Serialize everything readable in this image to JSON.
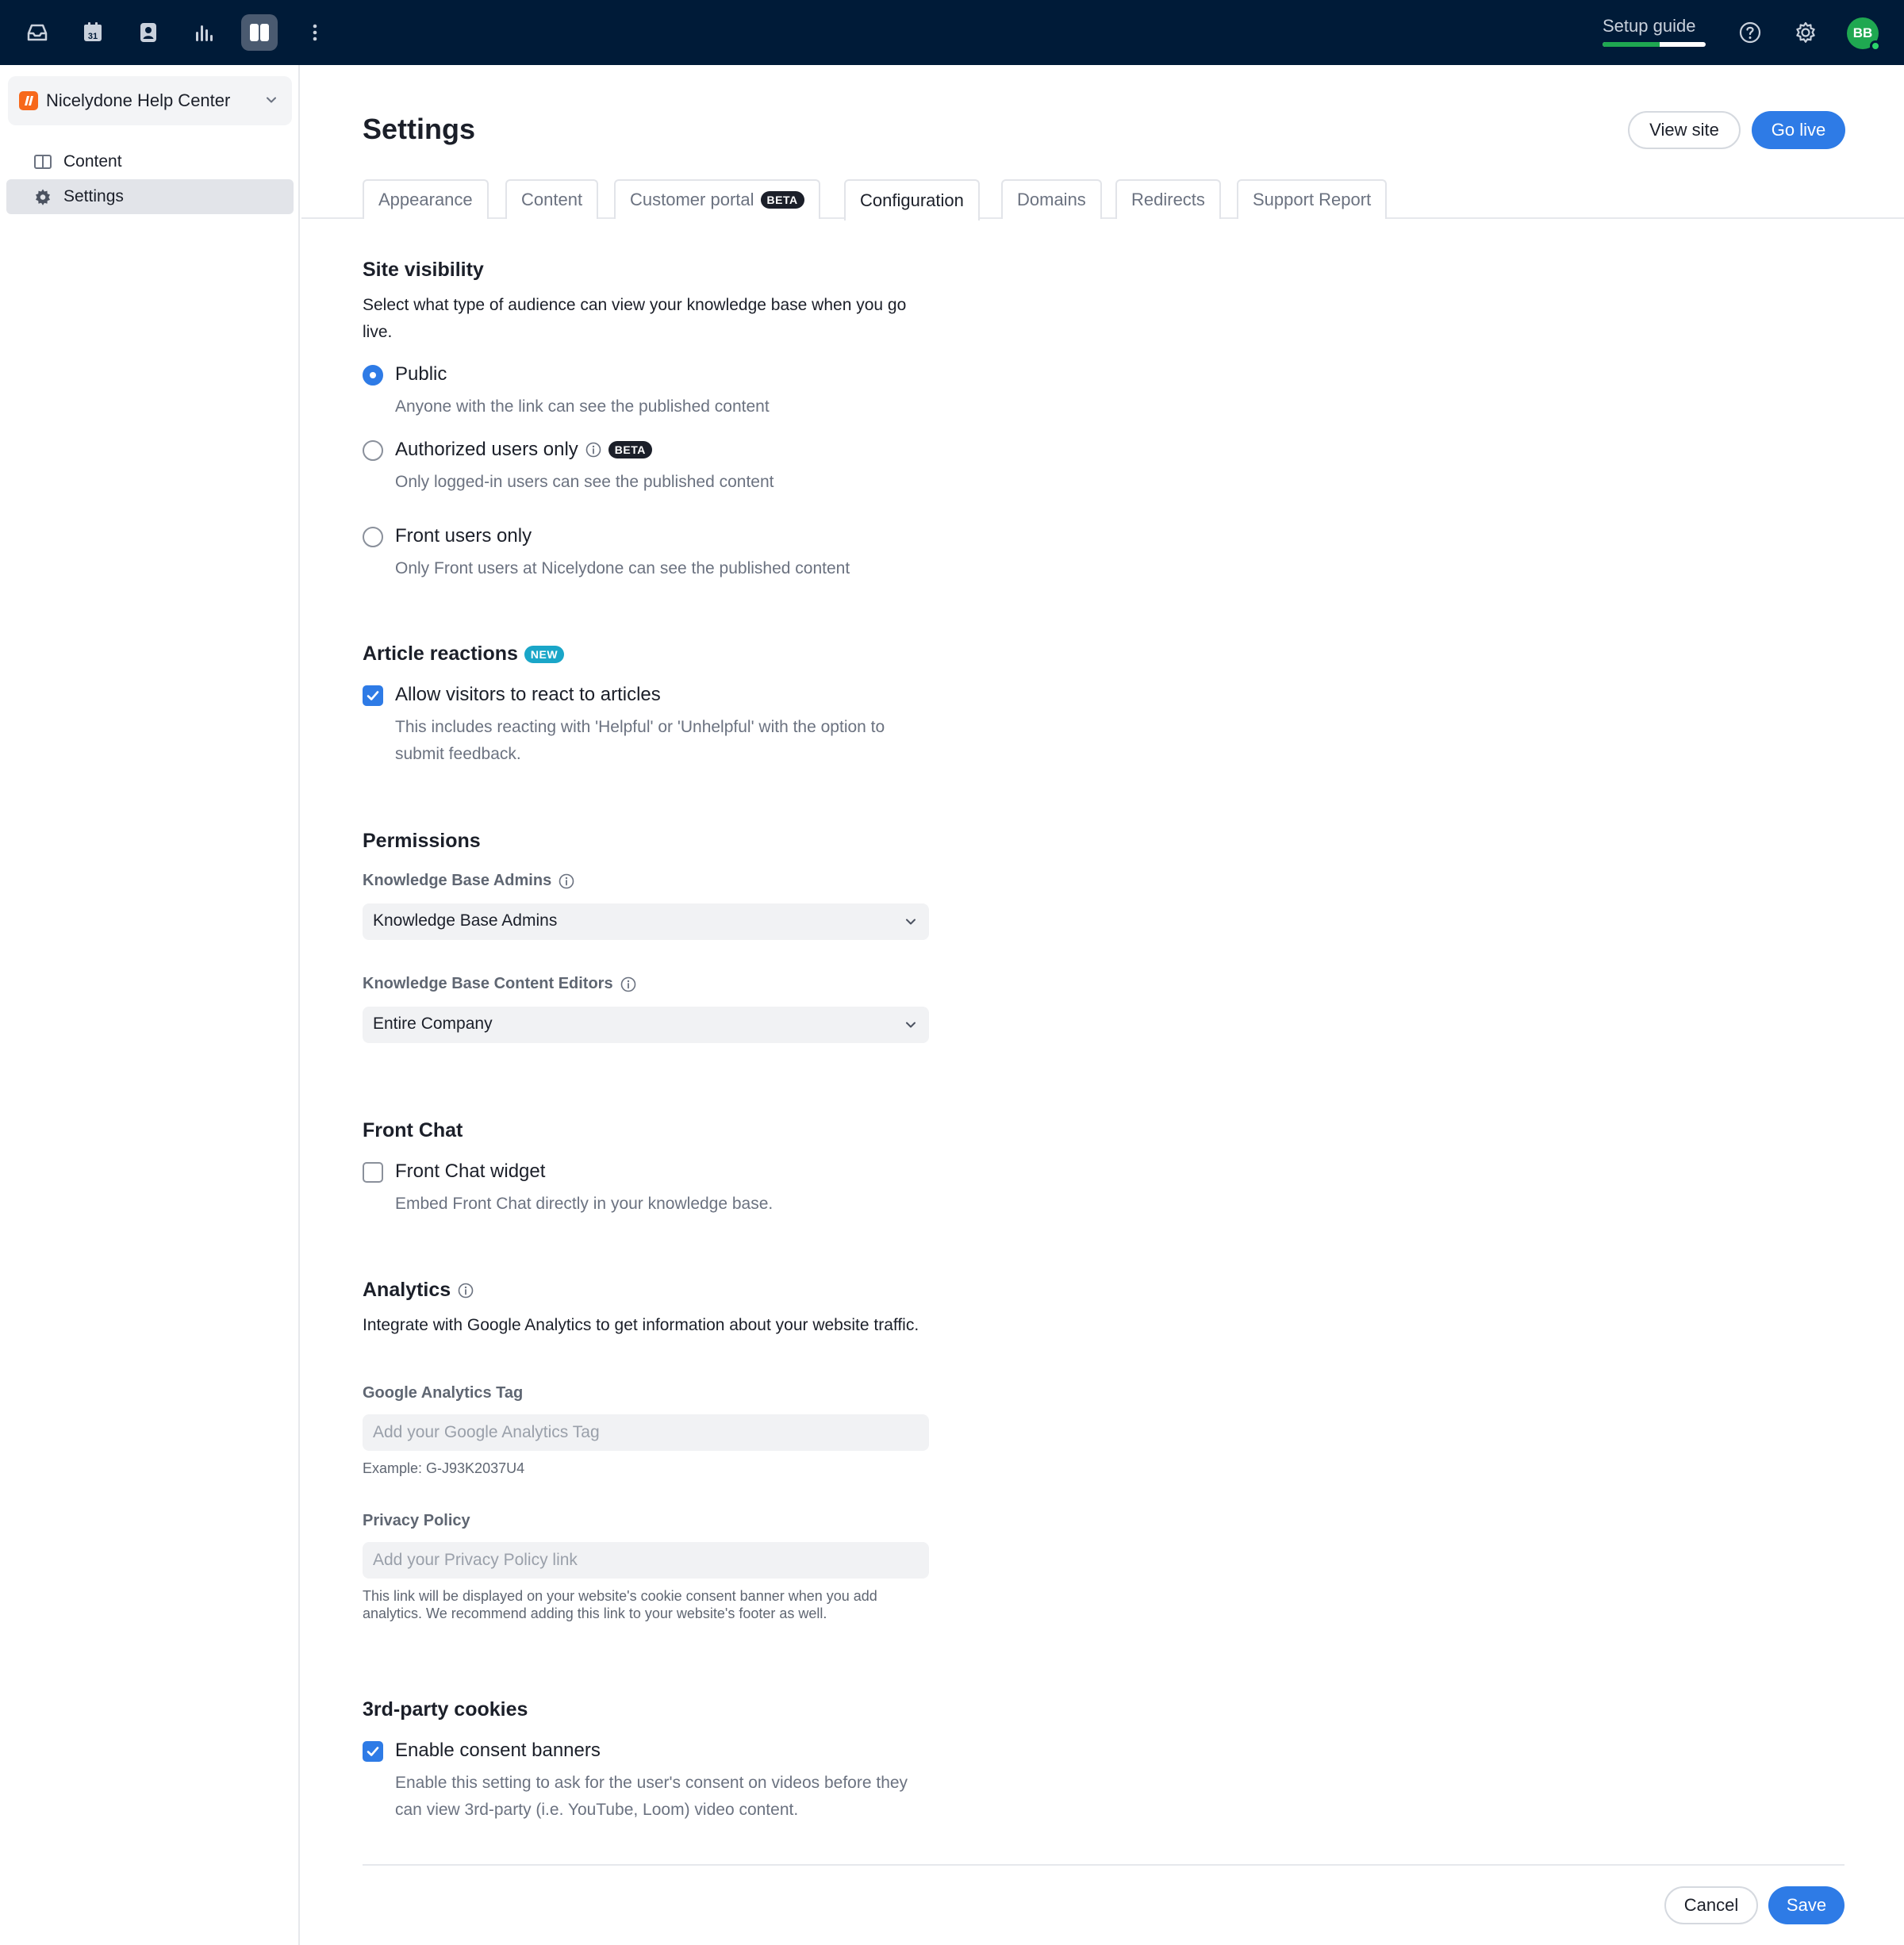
{
  "topbar": {
    "icons": [
      "inbox-icon",
      "calendar-icon",
      "contacts-icon",
      "analytics-icon",
      "knowledge-base-icon",
      "more-icon"
    ],
    "calendar_day": "31",
    "setup_guide": {
      "label": "Setup guide",
      "progress": 0.55
    },
    "help_icon": "help-icon",
    "settings_icon": "gear-icon",
    "avatar": "BB",
    "colors": {
      "bar": "#001b38",
      "progress": "#1fa851",
      "avatar": "#1fa851"
    }
  },
  "sidebar": {
    "kb_name": "Nicelydone Help Center",
    "items": [
      {
        "label": "Content",
        "icon": "book-icon",
        "active": false
      },
      {
        "label": "Settings",
        "icon": "gear-icon",
        "active": true
      }
    ]
  },
  "header": {
    "title": "Settings",
    "view_site": "View site",
    "go_live": "Go live",
    "accent": "#2e7be6"
  },
  "tabs": [
    {
      "label": "Appearance"
    },
    {
      "label": "Content"
    },
    {
      "label": "Customer portal",
      "badge": "BETA"
    },
    {
      "label": "Configuration",
      "active": true
    },
    {
      "label": "Domains"
    },
    {
      "label": "Redirects"
    },
    {
      "label": "Support Report"
    }
  ],
  "site_visibility": {
    "title": "Site visibility",
    "description": "Select what type of audience can view your knowledge base when you go live.",
    "options": [
      {
        "label": "Public",
        "description": "Anyone with the link can see the published content",
        "selected": true
      },
      {
        "label": "Authorized users only",
        "badge": "BETA",
        "description": "Only logged-in users can see the published content",
        "selected": false
      },
      {
        "label": "Front users only",
        "description": "Only Front users at Nicelydone can see the published content",
        "selected": false
      }
    ]
  },
  "article_reactions": {
    "title": "Article reactions",
    "badge": "NEW",
    "checkbox_label": "Allow visitors to react to articles",
    "checked": true,
    "description": "This includes reacting with 'Helpful' or 'Unhelpful' with the option to submit feedback."
  },
  "permissions": {
    "title": "Permissions",
    "admins_label": "Knowledge Base Admins",
    "admins_value": "Knowledge Base Admins",
    "editors_label": "Knowledge Base Content Editors",
    "editors_value": "Entire Company"
  },
  "front_chat": {
    "title": "Front Chat",
    "checkbox_label": "Front Chat widget",
    "checked": false,
    "description": "Embed Front Chat directly in your knowledge base."
  },
  "analytics": {
    "title": "Analytics",
    "description": "Integrate with Google Analytics to get information about your website traffic.",
    "ga_label": "Google Analytics Tag",
    "ga_placeholder": "Add your Google Analytics Tag",
    "ga_example": "Example: G-J93K2037U4",
    "privacy_label": "Privacy Policy",
    "privacy_placeholder": "Add your Privacy Policy link",
    "privacy_hint": "This link will be displayed on your website's cookie consent banner when you add analytics. We recommend adding this link to your website's footer as well."
  },
  "cookies": {
    "title": "3rd-party cookies",
    "checkbox_label": "Enable consent banners",
    "checked": true,
    "description": "Enable this setting to ask for the user's consent on videos before they can view 3rd-party (i.e. YouTube, Loom) video content."
  },
  "footer": {
    "cancel": "Cancel",
    "save": "Save"
  }
}
